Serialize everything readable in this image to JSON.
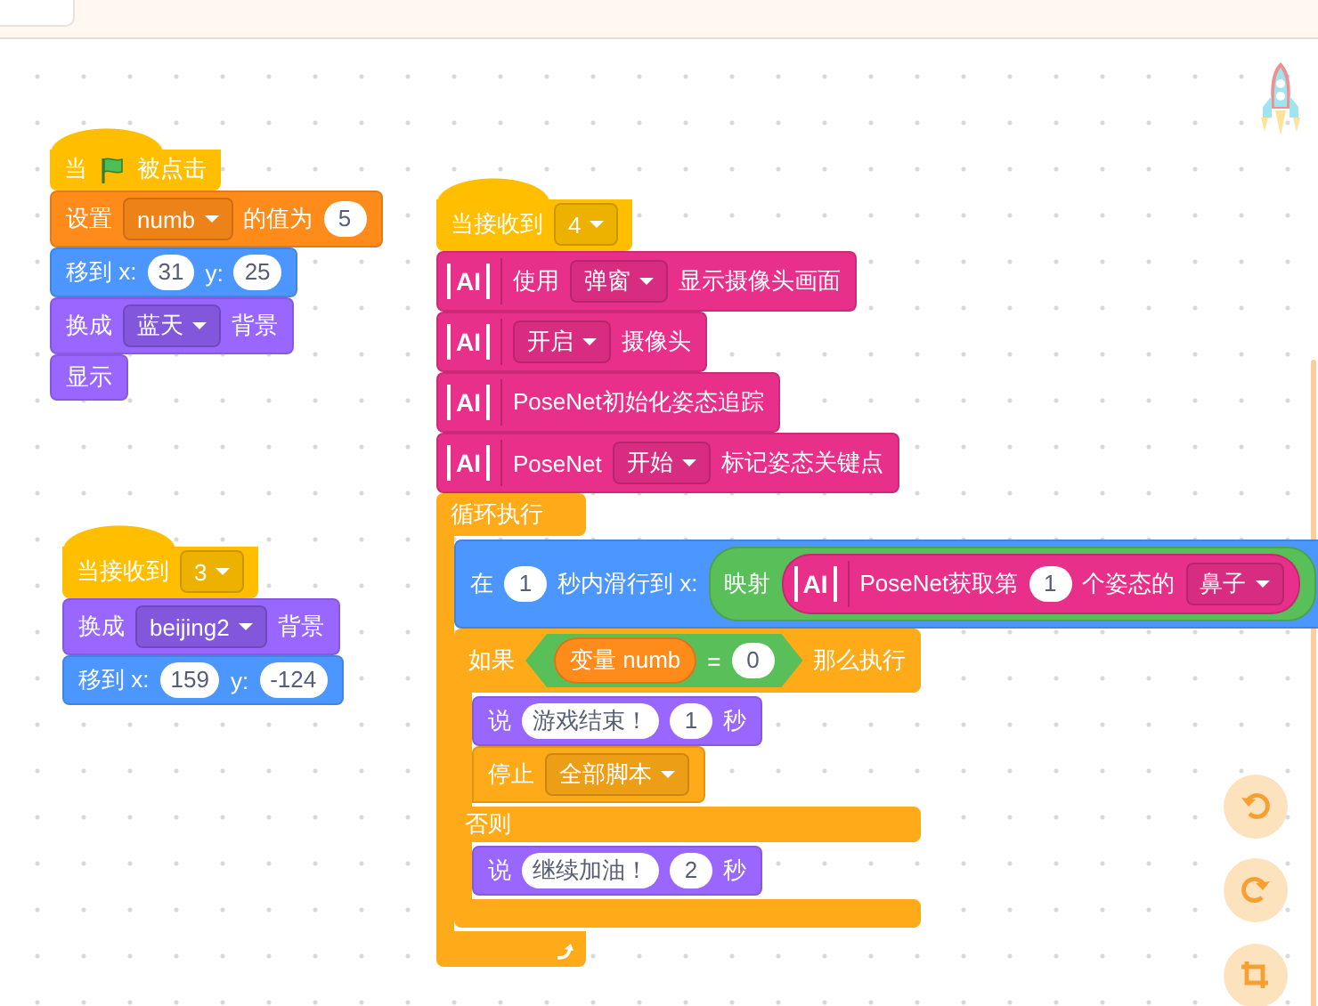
{
  "scripts": [
    {
      "blocks": [
        {
          "kind": "hat",
          "color": "#ffbf00",
          "parts": [
            {
              "kind": "text",
              "text": "当"
            },
            {
              "kind": "flag"
            },
            {
              "kind": "text",
              "text": "被点击"
            }
          ]
        },
        {
          "kind": "command",
          "color": "#ff8c1a",
          "parts": [
            {
              "kind": "text",
              "text": "设置"
            },
            {
              "kind": "dropdown",
              "text": "numb"
            },
            {
              "kind": "text",
              "text": "的值为"
            },
            {
              "kind": "number",
              "text": "5"
            }
          ]
        },
        {
          "kind": "command",
          "color": "#4c97ff",
          "parts": [
            {
              "kind": "text",
              "text": "移到 x:"
            },
            {
              "kind": "number",
              "text": "31"
            },
            {
              "kind": "text",
              "text": "y:"
            },
            {
              "kind": "number",
              "text": "25"
            }
          ]
        },
        {
          "kind": "command",
          "color": "#9966ff",
          "parts": [
            {
              "kind": "text",
              "text": "换成"
            },
            {
              "kind": "round_dropdown",
              "text": "蓝天"
            },
            {
              "kind": "text",
              "text": "背景"
            }
          ]
        },
        {
          "kind": "command",
          "color": "#9966ff",
          "parts": [
            {
              "kind": "text",
              "text": "显示"
            }
          ]
        }
      ]
    },
    {
      "blocks": [
        {
          "kind": "hat",
          "color": "#ffbf00",
          "parts": [
            {
              "kind": "text",
              "text": "当接收到"
            },
            {
              "kind": "dropdown",
              "text": "3"
            }
          ]
        },
        {
          "kind": "command",
          "color": "#9966ff",
          "parts": [
            {
              "kind": "text",
              "text": "换成"
            },
            {
              "kind": "round_dropdown",
              "text": "beijing2"
            },
            {
              "kind": "text",
              "text": "背景"
            }
          ]
        },
        {
          "kind": "command",
          "color": "#4c97ff",
          "parts": [
            {
              "kind": "text",
              "text": "移到 x:"
            },
            {
              "kind": "number",
              "text": "159"
            },
            {
              "kind": "text",
              "text": "y:"
            },
            {
              "kind": "number",
              "text": "-124"
            }
          ]
        }
      ]
    },
    {
      "blocks": [
        {
          "kind": "hat",
          "color": "#ffbf00",
          "parts": [
            {
              "kind": "text",
              "text": "当接收到"
            },
            {
              "kind": "dropdown",
              "text": "4"
            }
          ]
        },
        {
          "kind": "command",
          "color": "#e8308a",
          "parts": [
            {
              "kind": "ai",
              "text": "AI"
            },
            {
              "kind": "text",
              "text": "使用"
            },
            {
              "kind": "dropdown",
              "text": "弹窗"
            },
            {
              "kind": "text",
              "text": "显示摄像头画面"
            }
          ]
        },
        {
          "kind": "command",
          "color": "#e8308a",
          "parts": [
            {
              "kind": "ai",
              "text": "AI"
            },
            {
              "kind": "dropdown",
              "text": "开启"
            },
            {
              "kind": "text",
              "text": "摄像头"
            }
          ]
        },
        {
          "kind": "command",
          "color": "#e8308a",
          "parts": [
            {
              "kind": "ai",
              "text": "AI"
            },
            {
              "kind": "text",
              "text": "PoseNet初始化姿态追踪"
            }
          ]
        },
        {
          "kind": "command",
          "color": "#e8308a",
          "parts": [
            {
              "kind": "ai",
              "text": "AI"
            },
            {
              "kind": "text",
              "text": "PoseNet"
            },
            {
              "kind": "dropdown",
              "text": "开始"
            },
            {
              "kind": "text",
              "text": "标记姿态关键点"
            }
          ]
        },
        {
          "kind": "loop",
          "color": "#ffab19",
          "parts": [
            {
              "kind": "text",
              "text": "循环执行"
            }
          ],
          "body": [
            {
              "kind": "command",
              "color": "#4c97ff",
              "parts": [
                {
                  "kind": "text",
                  "text": "在"
                },
                {
                  "kind": "number",
                  "text": "1"
                },
                {
                  "kind": "text",
                  "text": "秒内滑行到 x:"
                },
                {
                  "kind": "reporter",
                  "color": "#59c059",
                  "parts": [
                    {
                      "kind": "text",
                      "text": "映射"
                    },
                    {
                      "kind": "reporter",
                      "color": "#e8308a",
                      "parts": [
                        {
                          "kind": "ai",
                          "text": "AI"
                        },
                        {
                          "kind": "text",
                          "text": "PoseNet获取第"
                        },
                        {
                          "kind": "number",
                          "text": "1"
                        },
                        {
                          "kind": "text",
                          "text": "个姿态的"
                        },
                        {
                          "kind": "dropdown",
                          "text": "鼻子"
                        }
                      ]
                    }
                  ]
                }
              ]
            },
            {
              "kind": "if_else",
              "color": "#ffab19",
              "parts": [
                {
                  "kind": "text",
                  "text": "如果"
                },
                {
                  "kind": "boolean",
                  "color": "#59c059",
                  "parts": [
                    {
                      "kind": "reporter",
                      "color": "#ff8c1a",
                      "parts": [
                        {
                          "kind": "text",
                          "text": "变量 numb"
                        }
                      ]
                    },
                    {
                      "kind": "text",
                      "text": "="
                    },
                    {
                      "kind": "number",
                      "text": "0"
                    }
                  ]
                },
                {
                  "kind": "text",
                  "text": "那么执行"
                }
              ],
              "body": [
                {
                  "kind": "command",
                  "color": "#9966ff",
                  "parts": [
                    {
                      "kind": "text",
                      "text": "说"
                    },
                    {
                      "kind": "string",
                      "text": "游戏结束！"
                    },
                    {
                      "kind": "number",
                      "text": "1"
                    },
                    {
                      "kind": "text",
                      "text": "秒"
                    }
                  ]
                },
                {
                  "kind": "cap",
                  "color": "#ffab19",
                  "parts": [
                    {
                      "kind": "text",
                      "text": "停止"
                    },
                    {
                      "kind": "dropdown",
                      "text": "全部脚本"
                    }
                  ]
                }
              ],
              "else_parts": [
                {
                  "kind": "text",
                  "text": "否则"
                }
              ],
              "else_body": [
                {
                  "kind": "command",
                  "color": "#9966ff",
                  "parts": [
                    {
                      "kind": "text",
                      "text": "说"
                    },
                    {
                      "kind": "string",
                      "text": "继续加油！"
                    },
                    {
                      "kind": "number",
                      "text": "2"
                    },
                    {
                      "kind": "text",
                      "text": "秒"
                    }
                  ]
                }
              ]
            }
          ]
        }
      ]
    }
  ]
}
